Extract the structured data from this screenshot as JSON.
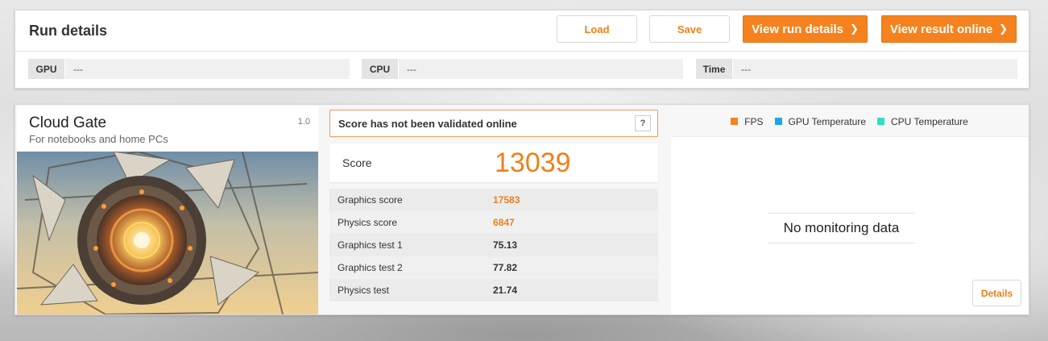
{
  "run": {
    "title": "Run details",
    "load_label": "Load",
    "save_label": "Save",
    "view_run_label": "View run details",
    "view_online_label": "View result online",
    "gpu": {
      "label": "GPU",
      "value": "---"
    },
    "cpu": {
      "label": "CPU",
      "value": "---"
    },
    "time": {
      "label": "Time",
      "value": "---"
    }
  },
  "benchmark": {
    "name": "Cloud Gate",
    "subtitle": "For notebooks and home PCs",
    "version": "1.0"
  },
  "validation": {
    "text": "Score has not been validated online",
    "help_label": "?"
  },
  "score": {
    "label": "Score",
    "value": "13039"
  },
  "results": [
    {
      "label": "Graphics score",
      "value": "17583",
      "highlight": true
    },
    {
      "label": "Physics score",
      "value": "6847",
      "highlight": true
    },
    {
      "label": "Graphics test 1",
      "value": "75.13",
      "highlight": false
    },
    {
      "label": "Graphics test 2",
      "value": "77.82",
      "highlight": false
    },
    {
      "label": "Physics test",
      "value": "21.74",
      "highlight": false
    }
  ],
  "monitoring": {
    "legend": [
      {
        "label": "FPS",
        "color": "#f5821f"
      },
      {
        "label": "GPU Temperature",
        "color": "#1aa9e8"
      },
      {
        "label": "CPU Temperature",
        "color": "#2ee0c0"
      }
    ],
    "no_data_text": "No monitoring data",
    "details_label": "Details"
  },
  "colors": {
    "accent": "#f5821f",
    "score_orange": "#f07f19"
  }
}
